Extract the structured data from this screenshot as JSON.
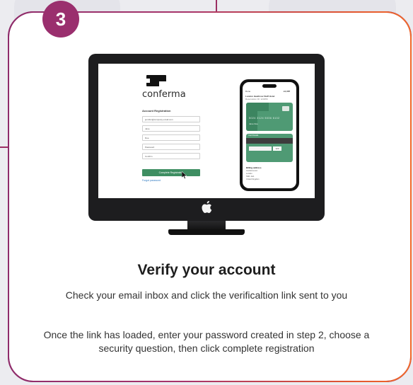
{
  "step": {
    "number": "3"
  },
  "screen": {
    "brand": "conferma",
    "form_title": "Account Registration",
    "fields": [
      "jennifer@company-email.com",
      "Jane",
      "Doe",
      "Password",
      "Confirm"
    ],
    "complete_button": "Complete Registration",
    "forgot_link": "Forgot password",
    "phone": {
      "header_left": "Done",
      "header_right": "£1,087",
      "account_title": "London Heathrow Staff Hotel",
      "account_sub": "Reservation ID: 123456",
      "card_number": "5024  3124  5036  6102",
      "card_name": "Jane Doe",
      "card2_title": "Card Details",
      "cvv": "123",
      "billing_title": "Billing address",
      "billing_lines": [
        "Conferma Ltd",
        "London",
        "SW1 1AA",
        "United Kingdom"
      ]
    }
  },
  "content": {
    "heading": "Verify your account",
    "paragraph1": "Check your email inbox and click the verificaltion link sent to you",
    "paragraph2": "Once the link has loaded, enter your password created in step 2, choose a security question, then click complete registration"
  },
  "colors": {
    "accent_purple": "#9a2f6e",
    "accent_orange": "#f26a2a",
    "card_green": "#4f9a74"
  }
}
